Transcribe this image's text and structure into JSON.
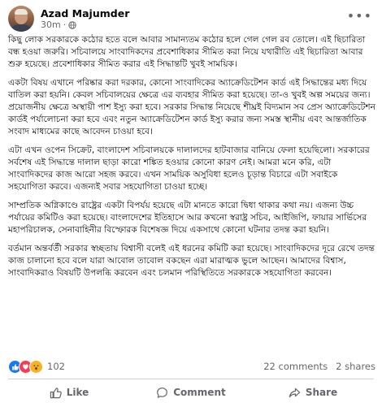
{
  "post": {
    "author": "Azad Majumder",
    "time": "30m",
    "paragraphs": [
      "কিছু লোক সরকারকে কঠোর হতে বলে আবার সামান্যতম কঠোর হলে গেল গেল রব তোলে। এই ছিচারিতা বন্ধ হওয়া জরুরি। সচিবালয়ে সাংবাদিকদের প্রবেশাধিকার সীমিত করা নিয়ে যথারীতি এই ছিচারিতা আবার শুরু হয়েছে। প্রবেশাধিকার সীমিত করার এই সিদ্ধান্তটি খুবই সাময়িক।",
      "একটা বিষয় এখানে পরিষ্কার করা দরকার, কোনো সাংবাদিকের অ্যাক্রেডিটেশন কার্ড এই সিদ্ধান্তের মধ্য দিয়ে বাতিল করা হয়নি। কেবল সচিবালয়ের ক্ষেত্রে এর ব্যবহার সীমিত করা হয়েছে। তা-ও খুবই অল্প সময়ের জন্য। প্রয়োজনীয় ক্ষেত্রে অস্থায়ী পাশ ইস্যু করা হবে। সরকার সিদ্ধান্ত নিয়েছে শীঘ্রই বিদ্যমান সব প্রেস অ্যাক্রেডিটেশন কার্ডই পর্যালোচনা করা হবে এবং নতুন অ্যাক্রেডিটেশন কার্ড ইস্যু করার জন্য সমস্ত স্থানীয় এবং আন্তর্জাতিক সংবাদ মাধ্যমের কাছে আবেদন চাওয়া হবে।",
      "এটা এখন ওপেন সিক্রেট, বাংলাদেশ সচিবালয়কে দালালদের হাটবাজার বানিয়ে ফেলা হয়েছিলো। সরকারের সর্বশেষ এই সিদ্ধান্তে দালাল ছাড়া কারো শঙ্কিত হওয়ার কোনো কারণ নেই। আমরা মনে করি, এটা সাংবাদিকদের কাজ আরো সহজ করবে। এখন সাময়িক অসুবিধা হলেও চূড়ান্ত বিচারে এটা সবাইকে সহযোগিতা করবে। এজন্যই সবার সহযোগিতা চাওয়া হচ্ছে।",
      "সাম্প্রতিক অগ্নিকাণ্ডে রাষ্ট্রের একটা বিপর্যয় হয়েছে এটা মানতে কারো দ্বিধা থাকার কথা নয়। এজন্য উচ্চ পর্যায়ের কমিটিও করা হয়েছে। বাংলাদেশের ইতিহাসে আর কখনো স্বরাষ্ট্র সচিব, আইজিপি, ফায়ার সার্ভিসের মহাপরিচালক, সেনাবাহিনীর বিস্ফোরক বিশেষজ্ঞ দিয়ে একসাথে কোনো ঘটনার তদন্ত করা হয়নি।",
      "বর্তমান অন্তর্বর্তী সরকার স্বচ্ছতায় বিশ্বাসী বলেই এই ধরনের কমিটি করা হয়েছে। সাংবাদিকদের দূরে রেখে তদন্ত কাজ চালানো হবে বলে যারা আবোল তাবোল বকছেন এরা মারাত্মক ভুলে আছেন। আমাদের বিশ্বাস, সাংবাদিকরাও বিষয়টি উপলব্ধি করবেন এবং চলমান পরিস্থিতিতে সরকারকে সহযোগিতা করবেন।"
    ]
  },
  "stats": {
    "reaction_count": "102",
    "comments": "22 comments",
    "shares": "2 shares"
  },
  "actions": {
    "like": "Like",
    "comment": "Comment",
    "share": "Share"
  },
  "colors": {
    "like_blue": "#1877f2",
    "love_red": "#f33e58",
    "wow_yellow": "#f7b125",
    "muted_text": "#65676b"
  },
  "icons": [
    "globe-icon",
    "more-options-icon",
    "like-reaction-icon",
    "love-reaction-icon",
    "wow-reaction-icon",
    "like-thumb-icon",
    "comment-bubble-icon",
    "share-arrow-icon"
  ]
}
